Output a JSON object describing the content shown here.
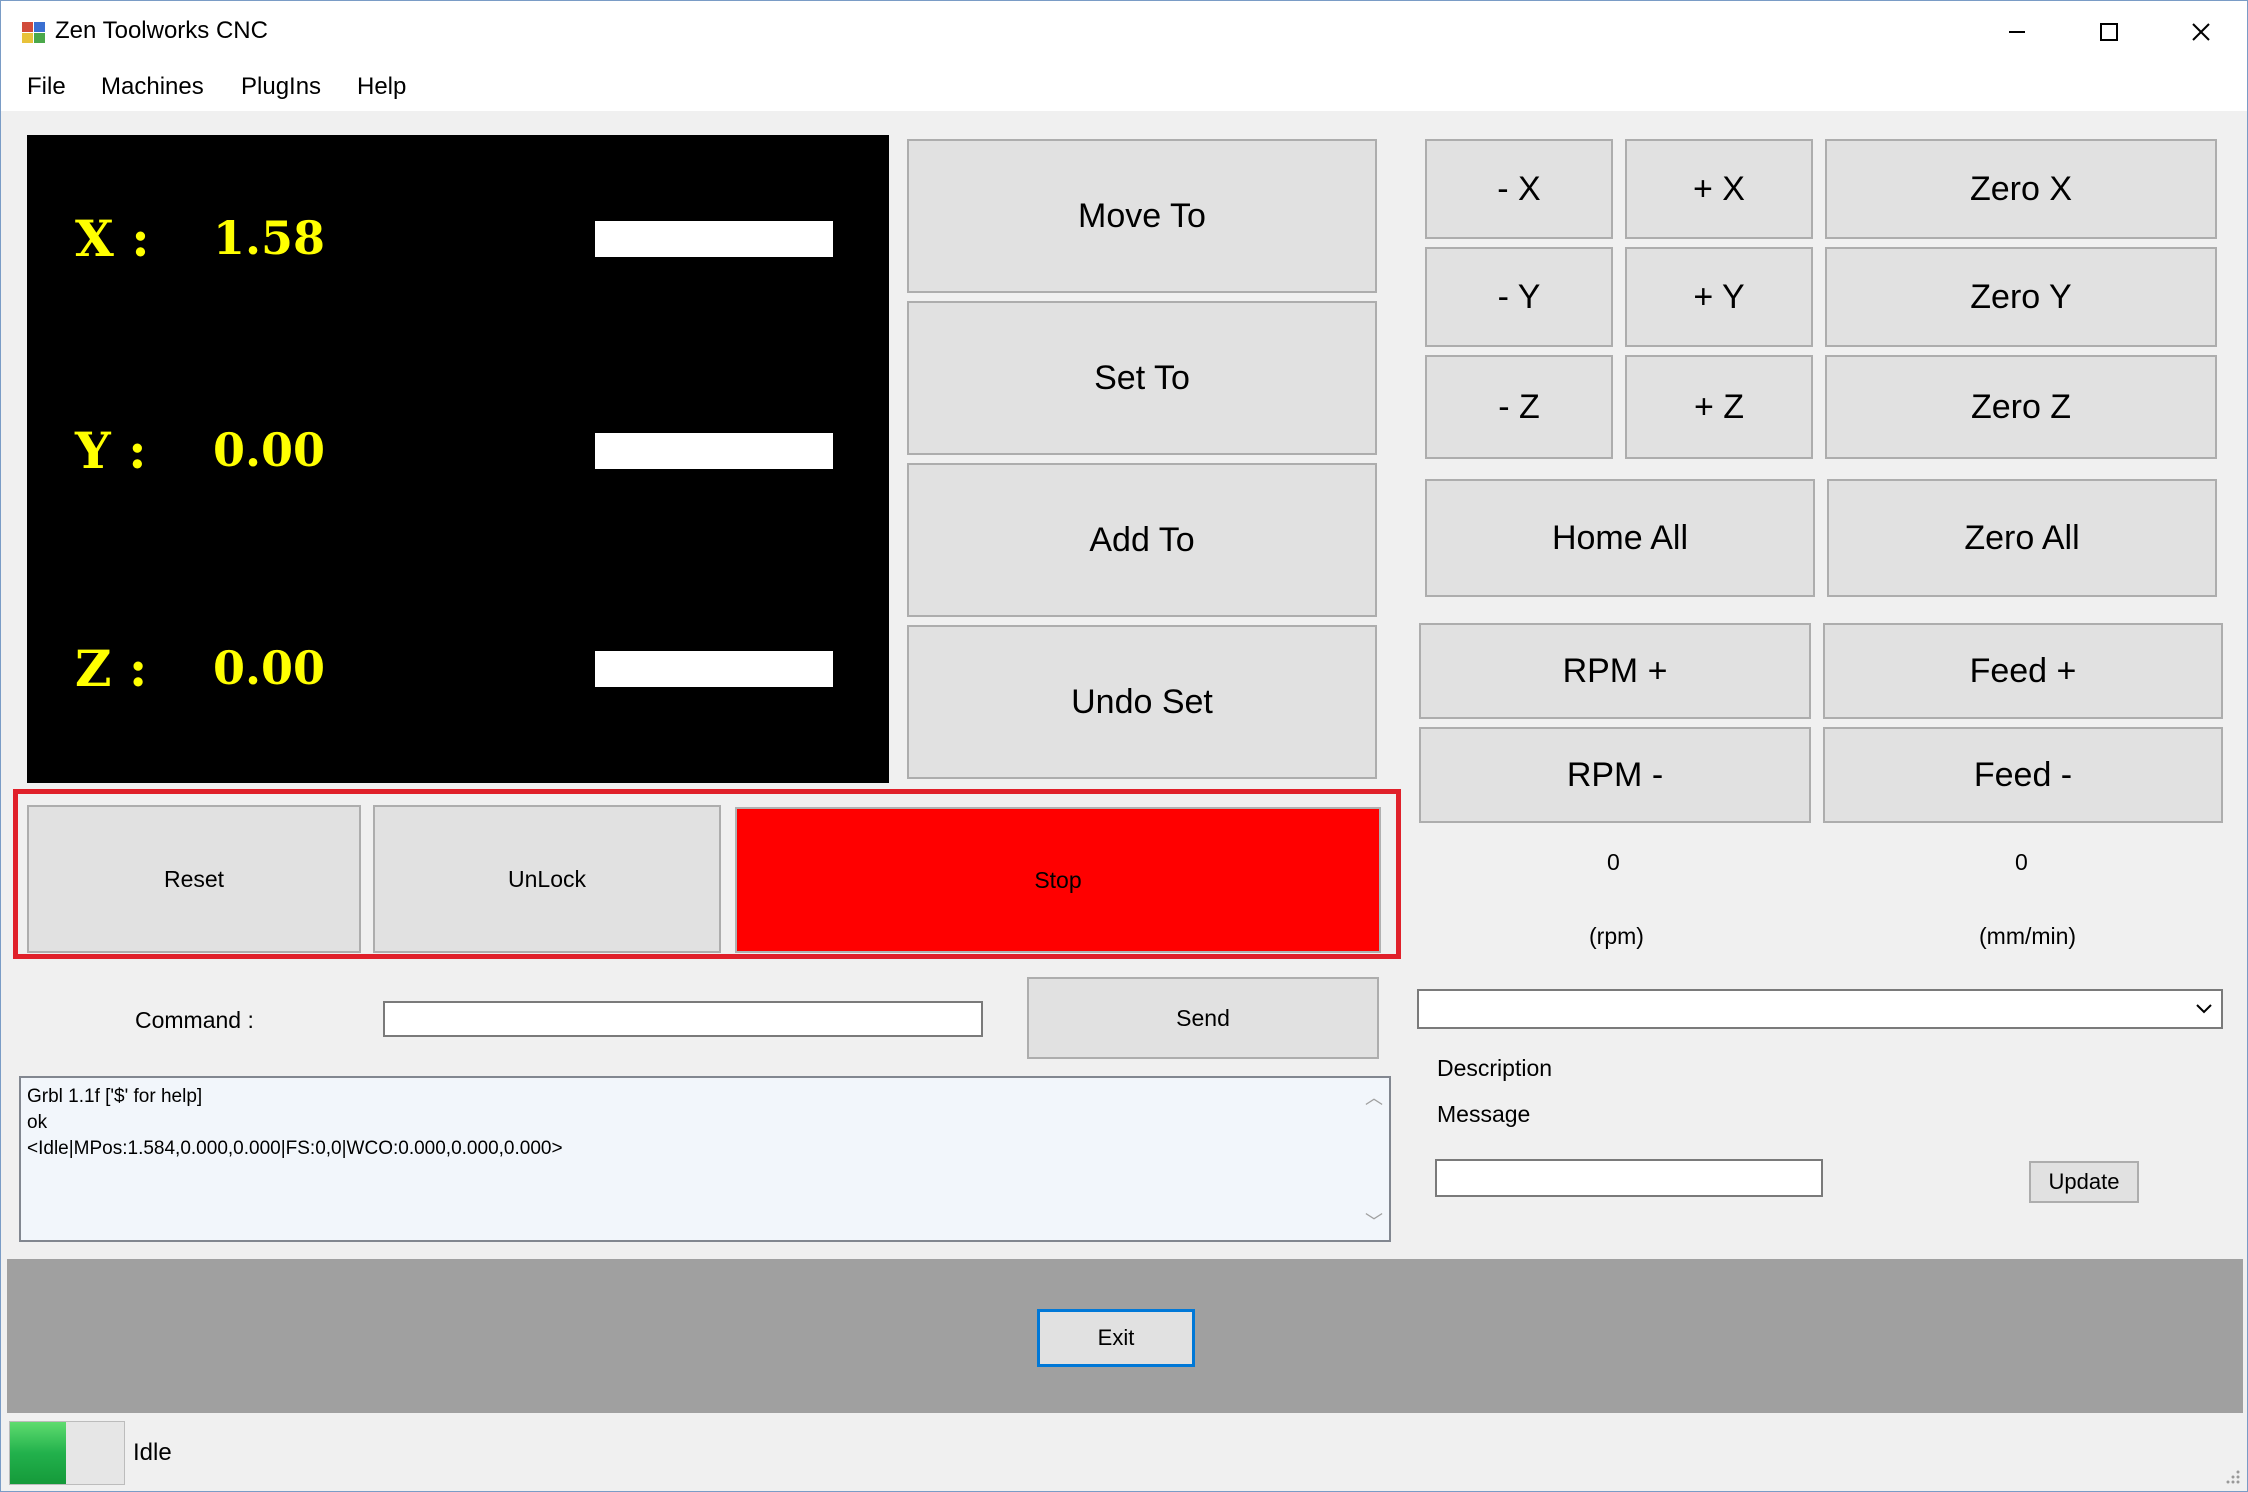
{
  "window": {
    "title": "Zen Toolworks  CNC",
    "minimize": "—",
    "maximize": "☐",
    "close": "✕"
  },
  "menu": [
    "File",
    "Machines",
    "PlugIns",
    "Help"
  ],
  "dro": {
    "x_label": "X :",
    "x_value": "1.58",
    "y_label": "Y :",
    "y_value": "0.00",
    "z_label": "Z :",
    "z_value": "0.00"
  },
  "move_buttons": {
    "move_to": "Move To",
    "set_to": "Set To",
    "add_to": "Add To",
    "undo_set": "Undo Set"
  },
  "jog": {
    "minus_x": "- X",
    "plus_x": "+ X",
    "zero_x": "Zero X",
    "minus_y": "- Y",
    "plus_y": "+ Y",
    "zero_y": "Zero Y",
    "minus_z": "- Z",
    "plus_z": "+ Z",
    "zero_z": "Zero Z",
    "home_all": "Home All",
    "zero_all": "Zero All"
  },
  "override": {
    "rpm_plus": "RPM +",
    "feed_plus": "Feed +",
    "rpm_minus": "RPM -",
    "feed_minus": "Feed -",
    "rpm_value": "0",
    "feed_value": "0",
    "rpm_unit": "(rpm)",
    "feed_unit": "(mm/min)"
  },
  "control": {
    "reset": "Reset",
    "unlock": "UnLock",
    "stop": "Stop"
  },
  "command": {
    "label": "Command :",
    "value": "",
    "send": "Send"
  },
  "console": {
    "lines": [
      "Grbl 1.1f ['$' for help]",
      "ok",
      "<Idle|MPos:1.584,0.000,0.000|FS:0,0|WCO:0.000,0.000,0.000>"
    ]
  },
  "plugin": {
    "selected": "",
    "description_label": "Description",
    "message_label": "Message",
    "message_value": "",
    "update": "Update"
  },
  "exit": "Exit",
  "status": {
    "text": "Idle",
    "indicator_color": "#22b14c"
  },
  "colors": {
    "stop": "#ff0000",
    "stop_frame": "#e0202a",
    "dro_text": "#ffff00",
    "dro_bg": "#000000"
  }
}
